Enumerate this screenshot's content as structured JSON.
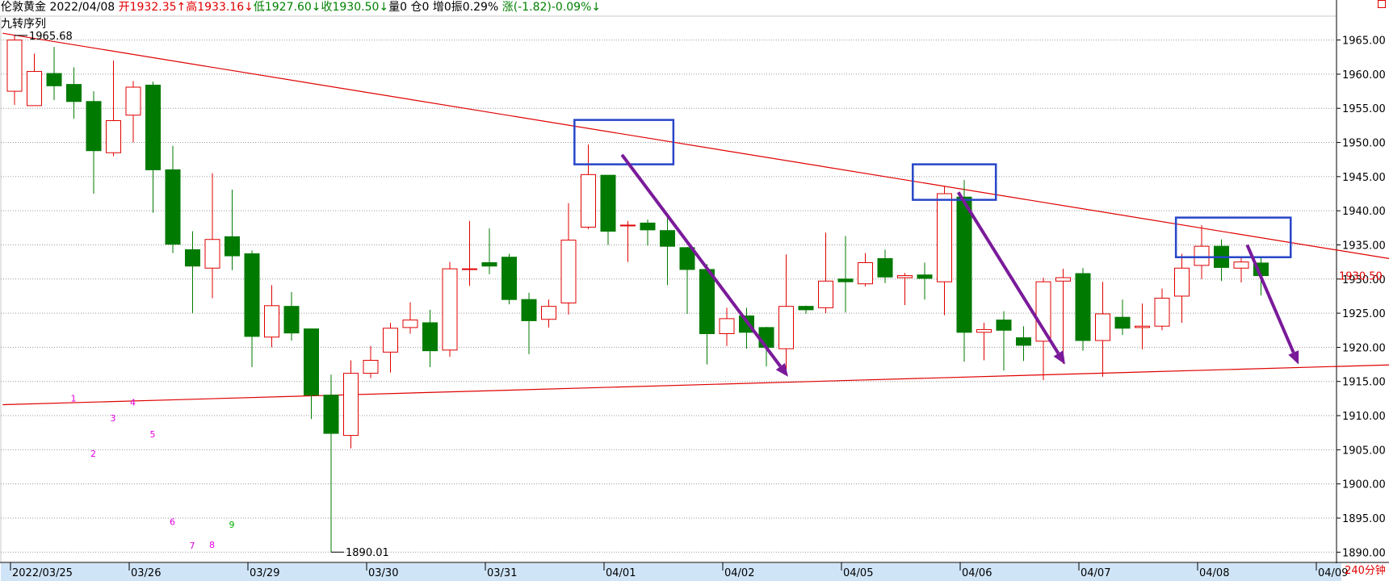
{
  "header": {
    "instrument": "伦敦黄金",
    "date": "2022/04/08",
    "open": "开1932.35↑",
    "high": "高1933.16↓",
    "low": "低1927.60↓",
    "close": "收1930.50↓",
    "volume": "量0",
    "position": "仓0",
    "increase": "增0",
    "amplitude": "振0.29%",
    "change": "涨(-1.82)-0.09%↓"
  },
  "indicator_label": "九转序列",
  "period_label": "240分钟",
  "current_price_label": "1930.50",
  "colors": {
    "up": "#e00000",
    "down": "#007a00",
    "trend": "#e00000",
    "box": "#2846c8",
    "arrow": "#7a1a9a",
    "seq_pink": "#e000e0",
    "seq_green": "#00b000"
  },
  "chart_data": {
    "type": "candlestick",
    "ylim": [
      1888.5,
      1968.5
    ],
    "y_ticks": [
      1890,
      1895,
      1900,
      1905,
      1910,
      1915,
      1920,
      1925,
      1930,
      1935,
      1940,
      1945,
      1950,
      1955,
      1960,
      1965
    ],
    "y_tick_labels": [
      "1890.00",
      "1895.00",
      "1900.00",
      "1905.00",
      "1910.00",
      "1915.00",
      "1920.00",
      "1925.00",
      "1930.00",
      "1935.00",
      "1940.00",
      "1945.00",
      "1950.00",
      "1955.00",
      "1960.00",
      "1965.00"
    ],
    "x_labels": [
      {
        "label": "2022/03/25",
        "index": 0
      },
      {
        "label": "03/26",
        "index": 6
      },
      {
        "label": "03/29",
        "index": 12
      },
      {
        "label": "03/30",
        "index": 18
      },
      {
        "label": "03/31",
        "index": 24
      },
      {
        "label": "04/01",
        "index": 30
      },
      {
        "label": "04/02",
        "index": 36
      },
      {
        "label": "04/05",
        "index": 42
      },
      {
        "label": "04/06",
        "index": 48
      },
      {
        "label": "04/07",
        "index": 54
      },
      {
        "label": "04/08",
        "index": 60
      },
      {
        "label": "04/09",
        "index": 66
      }
    ],
    "candles": [
      [
        1957.5,
        1965.0,
        1965.7,
        1955.5
      ],
      [
        1955.4,
        1960.4,
        1963.0,
        1956.8
      ],
      [
        1960.1,
        1958.3,
        1964.0,
        1956.2
      ],
      [
        1958.5,
        1956.0,
        1961.0,
        1953.5
      ],
      [
        1956.0,
        1948.8,
        1957.5,
        1942.5
      ],
      [
        1948.5,
        1953.2,
        1962.0,
        1948.0
      ],
      [
        1954.0,
        1958.1,
        1959.0,
        1950.0
      ],
      [
        1958.4,
        1946.0,
        1958.9,
        1939.7
      ],
      [
        1946.0,
        1935.1,
        1949.5,
        1933.8
      ],
      [
        1934.3,
        1931.9,
        1937.0,
        1925.0
      ],
      [
        1931.6,
        1935.8,
        1945.5,
        1927.2
      ],
      [
        1936.2,
        1933.4,
        1943.1,
        1931.3
      ],
      [
        1933.7,
        1921.6,
        1934.2,
        1917.1
      ],
      [
        1921.5,
        1926.1,
        1929.1,
        1920.0
      ],
      [
        1926.0,
        1922.1,
        1928.1,
        1921.0
      ],
      [
        1922.7,
        1913.0,
        1922.7,
        1909.5
      ],
      [
        1913.0,
        1907.4,
        1916.0,
        1890.0
      ],
      [
        1907.1,
        1916.2,
        1918.1,
        1905.2
      ],
      [
        1916.2,
        1918.1,
        1920.2,
        1915.5
      ],
      [
        1919.3,
        1922.8,
        1923.6,
        1916.3
      ],
      [
        1922.9,
        1924.0,
        1926.6,
        1922.0
      ],
      [
        1923.6,
        1919.5,
        1925.5,
        1917.1
      ],
      [
        1919.6,
        1931.5,
        1932.5,
        1918.6
      ],
      [
        1931.4,
        1931.5,
        1938.5,
        1929.0
      ],
      [
        1932.4,
        1931.9,
        1937.4,
        1930.7
      ],
      [
        1933.2,
        1927.0,
        1933.7,
        1926.3
      ],
      [
        1927.0,
        1923.9,
        1928.0,
        1919.0
      ],
      [
        1924.1,
        1926.0,
        1927.0,
        1922.9
      ],
      [
        1926.5,
        1935.7,
        1941.1,
        1924.8
      ],
      [
        1937.6,
        1945.3,
        1949.7,
        1937.3
      ],
      [
        1945.2,
        1937.0,
        1945.2,
        1935.0
      ],
      [
        1937.9,
        1937.9,
        1938.5,
        1932.5
      ],
      [
        1938.2,
        1937.2,
        1938.7,
        1934.9
      ],
      [
        1937.1,
        1934.8,
        1939.0,
        1929.1
      ],
      [
        1934.6,
        1931.4,
        1934.7,
        1924.9
      ],
      [
        1931.4,
        1922.0,
        1932.2,
        1917.5
      ],
      [
        1922.0,
        1924.2,
        1925.8,
        1920.2
      ],
      [
        1924.6,
        1922.2,
        1925.8,
        1919.8
      ],
      [
        1922.9,
        1920.0,
        1923.0,
        1917.2
      ],
      [
        1919.8,
        1926.0,
        1933.6,
        1916.0
      ],
      [
        1926.0,
        1925.5,
        1926.1,
        1924.9
      ],
      [
        1925.8,
        1929.7,
        1936.8,
        1925.0
      ],
      [
        1930.0,
        1929.6,
        1936.3,
        1925.1
      ],
      [
        1929.3,
        1932.4,
        1933.8,
        1928.9
      ],
      [
        1933.0,
        1930.3,
        1934.3,
        1929.4
      ],
      [
        1930.2,
        1930.5,
        1930.9,
        1926.2
      ],
      [
        1930.6,
        1930.1,
        1932.4,
        1927.0
      ],
      [
        1929.6,
        1942.5,
        1943.6,
        1924.7
      ],
      [
        1942.0,
        1922.2,
        1944.5,
        1917.9
      ],
      [
        1922.2,
        1922.6,
        1923.6,
        1918.1
      ],
      [
        1924.0,
        1922.5,
        1925.3,
        1916.6
      ],
      [
        1921.4,
        1920.3,
        1923.1,
        1918.0
      ],
      [
        1920.9,
        1929.6,
        1930.2,
        1915.2
      ],
      [
        1929.7,
        1930.2,
        1931.5,
        1917.6
      ],
      [
        1930.8,
        1921.0,
        1931.6,
        1919.5
      ],
      [
        1921.0,
        1924.9,
        1929.6,
        1915.7
      ],
      [
        1924.4,
        1922.8,
        1927.0,
        1921.8
      ],
      [
        1922.9,
        1923.1,
        1926.4,
        1919.7
      ],
      [
        1923.1,
        1927.2,
        1928.6,
        1922.5
      ],
      [
        1927.5,
        1931.6,
        1933.7,
        1923.6
      ],
      [
        1932.0,
        1934.8,
        1937.9,
        1930.0
      ],
      [
        1934.8,
        1931.7,
        1935.8,
        1929.7
      ],
      [
        1931.6,
        1932.5,
        1933.2,
        1929.5
      ],
      [
        1932.35,
        1930.5,
        1933.16,
        1927.6
      ]
    ],
    "extreme_labels": [
      {
        "label": "1965.68",
        "value": 1965.68,
        "index": 0
      },
      {
        "label": "1890.01",
        "value": 1890.01,
        "index": 16
      }
    ],
    "sequence_marks": [
      {
        "label": "1",
        "index": 3,
        "value": 1912.1,
        "color": "pink"
      },
      {
        "label": "2",
        "index": 4,
        "value": 1904.0,
        "color": "pink"
      },
      {
        "label": "3",
        "index": 5,
        "value": 1909.2,
        "color": "pink"
      },
      {
        "label": "4",
        "index": 6,
        "value": 1911.5,
        "color": "pink"
      },
      {
        "label": "5",
        "index": 7,
        "value": 1906.8,
        "color": "pink"
      },
      {
        "label": "6",
        "index": 8,
        "value": 1894.0,
        "color": "pink"
      },
      {
        "label": "7",
        "index": 9,
        "value": 1890.5,
        "color": "pink"
      },
      {
        "label": "8",
        "index": 10,
        "value": 1890.6,
        "color": "pink"
      },
      {
        "label": "9",
        "index": 11,
        "value": 1893.6,
        "color": "green"
      }
    ],
    "trend_lines": [
      {
        "name": "resistance",
        "from": {
          "index": -0.6,
          "value": 1966.0
        },
        "to": {
          "index": 71.6,
          "value": 1932.0
        }
      },
      {
        "name": "support",
        "from": {
          "index": -0.6,
          "value": 1911.6
        },
        "to": {
          "index": 71.6,
          "value": 1917.6
        }
      }
    ],
    "boxes": [
      {
        "from": {
          "index": 28.3,
          "value": 1953.3
        },
        "to": {
          "index": 33.3,
          "value": 1946.8
        }
      },
      {
        "from": {
          "index": 45.4,
          "value": 1946.8
        },
        "to": {
          "index": 49.6,
          "value": 1941.6
        }
      },
      {
        "from": {
          "index": 58.7,
          "value": 1939.0
        },
        "to": {
          "index": 64.5,
          "value": 1933.2
        }
      }
    ],
    "arrows": [
      {
        "from": {
          "index": 30.7,
          "value": 1948.2
        },
        "to": {
          "index": 39.1,
          "value": 1915.7
        }
      },
      {
        "from": {
          "index": 47.7,
          "value": 1942.7
        },
        "to": {
          "index": 53.1,
          "value": 1917.5
        }
      },
      {
        "from": {
          "index": 62.3,
          "value": 1935.0
        },
        "to": {
          "index": 64.9,
          "value": 1917.5
        }
      }
    ]
  }
}
